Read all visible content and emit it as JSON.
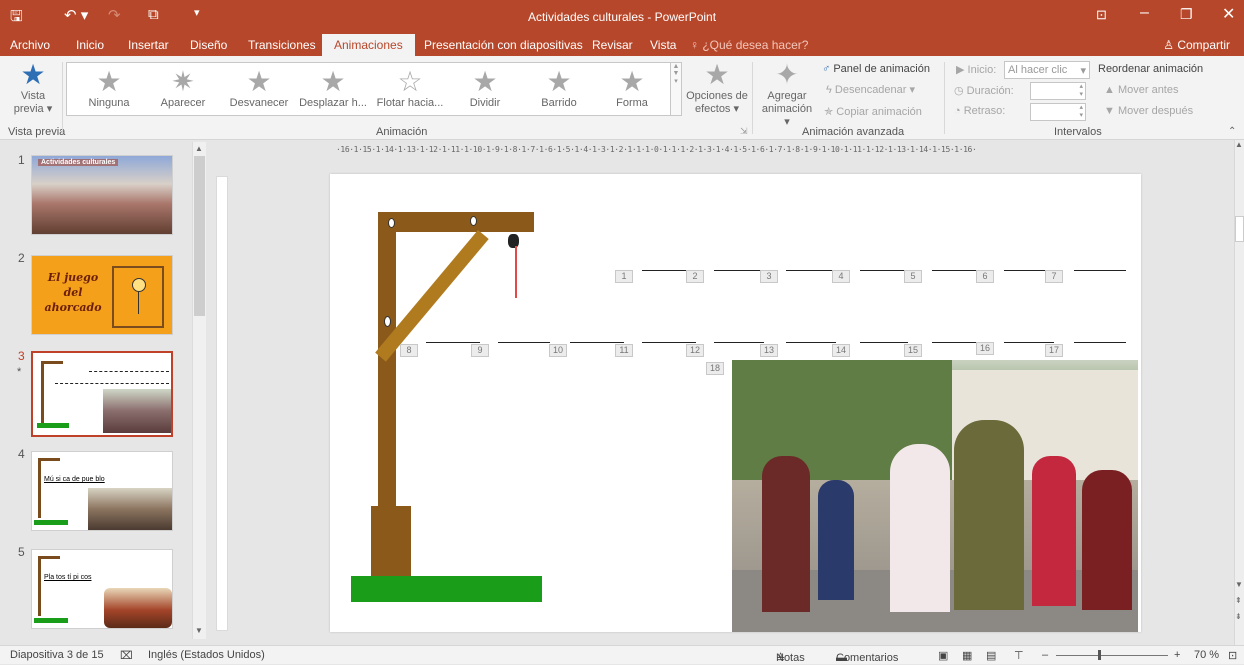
{
  "app": {
    "title": "Actividades culturales - PowerPoint",
    "accent": "#b7472a"
  },
  "tabs": [
    "Archivo",
    "Inicio",
    "Insertar",
    "Diseño",
    "Transiciones",
    "Animaciones",
    "Presentación con diapositivas",
    "Revisar",
    "Vista"
  ],
  "active_tab": "Animaciones",
  "tell_me": "¿Qué desea hacer?",
  "share_label": "Compartir",
  "ribbon": {
    "preview": {
      "label1": "Vista",
      "label2": "previa",
      "group": "Vista previa"
    },
    "animations": [
      "Ninguna",
      "Aparecer",
      "Desvanecer",
      "Desplazar h...",
      "Flotar hacia...",
      "Dividir",
      "Barrido",
      "Forma"
    ],
    "animation_group": "Animación",
    "effect_options": {
      "label1": "Opciones de",
      "label2": "efectos"
    },
    "add_animation": {
      "label1": "Agregar",
      "label2": "animación"
    },
    "animation_panel": "Panel de animación",
    "trigger": "Desencadenar",
    "copy_animation": "Copiar animación",
    "advanced_group": "Animación avanzada",
    "start_label": "Inicio:",
    "start_value": "Al hacer clic",
    "duration_label": "Duración:",
    "delay_label": "Retraso:",
    "reorder_title": "Reordenar animación",
    "move_before": "Mover antes",
    "move_after": "Mover después",
    "timing_group": "Intervalos"
  },
  "slides": [
    {
      "number": "1",
      "title": "Actividades culturales"
    },
    {
      "number": "2",
      "title": "El juego del ahorcado"
    },
    {
      "number": "3",
      "title": ""
    },
    {
      "number": "4",
      "title": "Mú si ca de pue blo"
    },
    {
      "number": "5",
      "title": "Pla tos tí pi cos"
    }
  ],
  "selected_slide": "3",
  "ruler_text": "·16·1·15·1·14·1·13·1·12·1·11·1·10·1·9·1·8·1·7·1·6·1·5·1·4·1·3·1·2·1·1·1·0·1·1·1·2·1·3·1·4·1·5·1·6·1·7·1·8·1·9·1·10·1·11·1·12·1·13·1·14·1·15·1·16·",
  "blank_numbers": [
    "1",
    "2",
    "3",
    "4",
    "5",
    "6",
    "7",
    "8",
    "9",
    "10",
    "11",
    "12",
    "13",
    "14",
    "15",
    "16",
    "17",
    "18"
  ],
  "status": {
    "slide_info": "Diapositiva 3 de 15",
    "language": "Inglés (Estados Unidos)",
    "notes": "Notas",
    "comments": "Comentarios",
    "zoom": "70 %"
  }
}
